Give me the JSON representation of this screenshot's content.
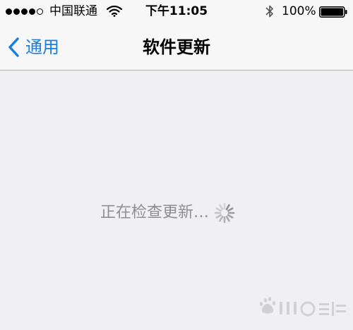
{
  "status_bar": {
    "signal_strength": 4,
    "signal_total": 5,
    "carrier": "中国联通",
    "wifi_icon": "wifi-icon",
    "time": "下午11:05",
    "bluetooth_icon": "bluetooth-icon",
    "battery_percent": "100%",
    "battery_level": 1.0
  },
  "nav": {
    "back_label": "通用",
    "title": "软件更新",
    "accent_color": "#1a7ee0"
  },
  "main": {
    "status_text": "正在检查更新…",
    "spinner_icon": "activity-spinner-icon"
  }
}
